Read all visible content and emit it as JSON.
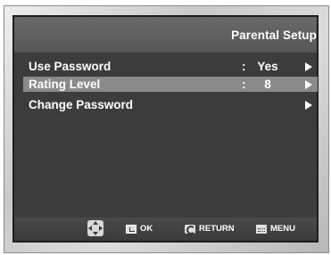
{
  "header": {
    "title": "Parental Setup"
  },
  "menu": {
    "items": [
      {
        "label": "Use Password",
        "colon": ":",
        "value": "Yes",
        "icon": "chevron-right-icon"
      },
      {
        "label": "Rating Level",
        "colon": ":",
        "value": "8",
        "icon": "chevron-right-icon",
        "selected": true
      },
      {
        "label": "Change Password",
        "colon": "",
        "value": "",
        "icon": "chevron-right-icon"
      }
    ]
  },
  "footer": {
    "nav_icon": "dpad-icon",
    "ok_label": "OK",
    "return_label": "RETURN",
    "menu_label": "MENU"
  },
  "colors": {
    "screen_bg": "#3c3c3c",
    "header_bg": "#5e5e5e",
    "selected_row": "#8a8a8a",
    "text": "#ffffff"
  }
}
